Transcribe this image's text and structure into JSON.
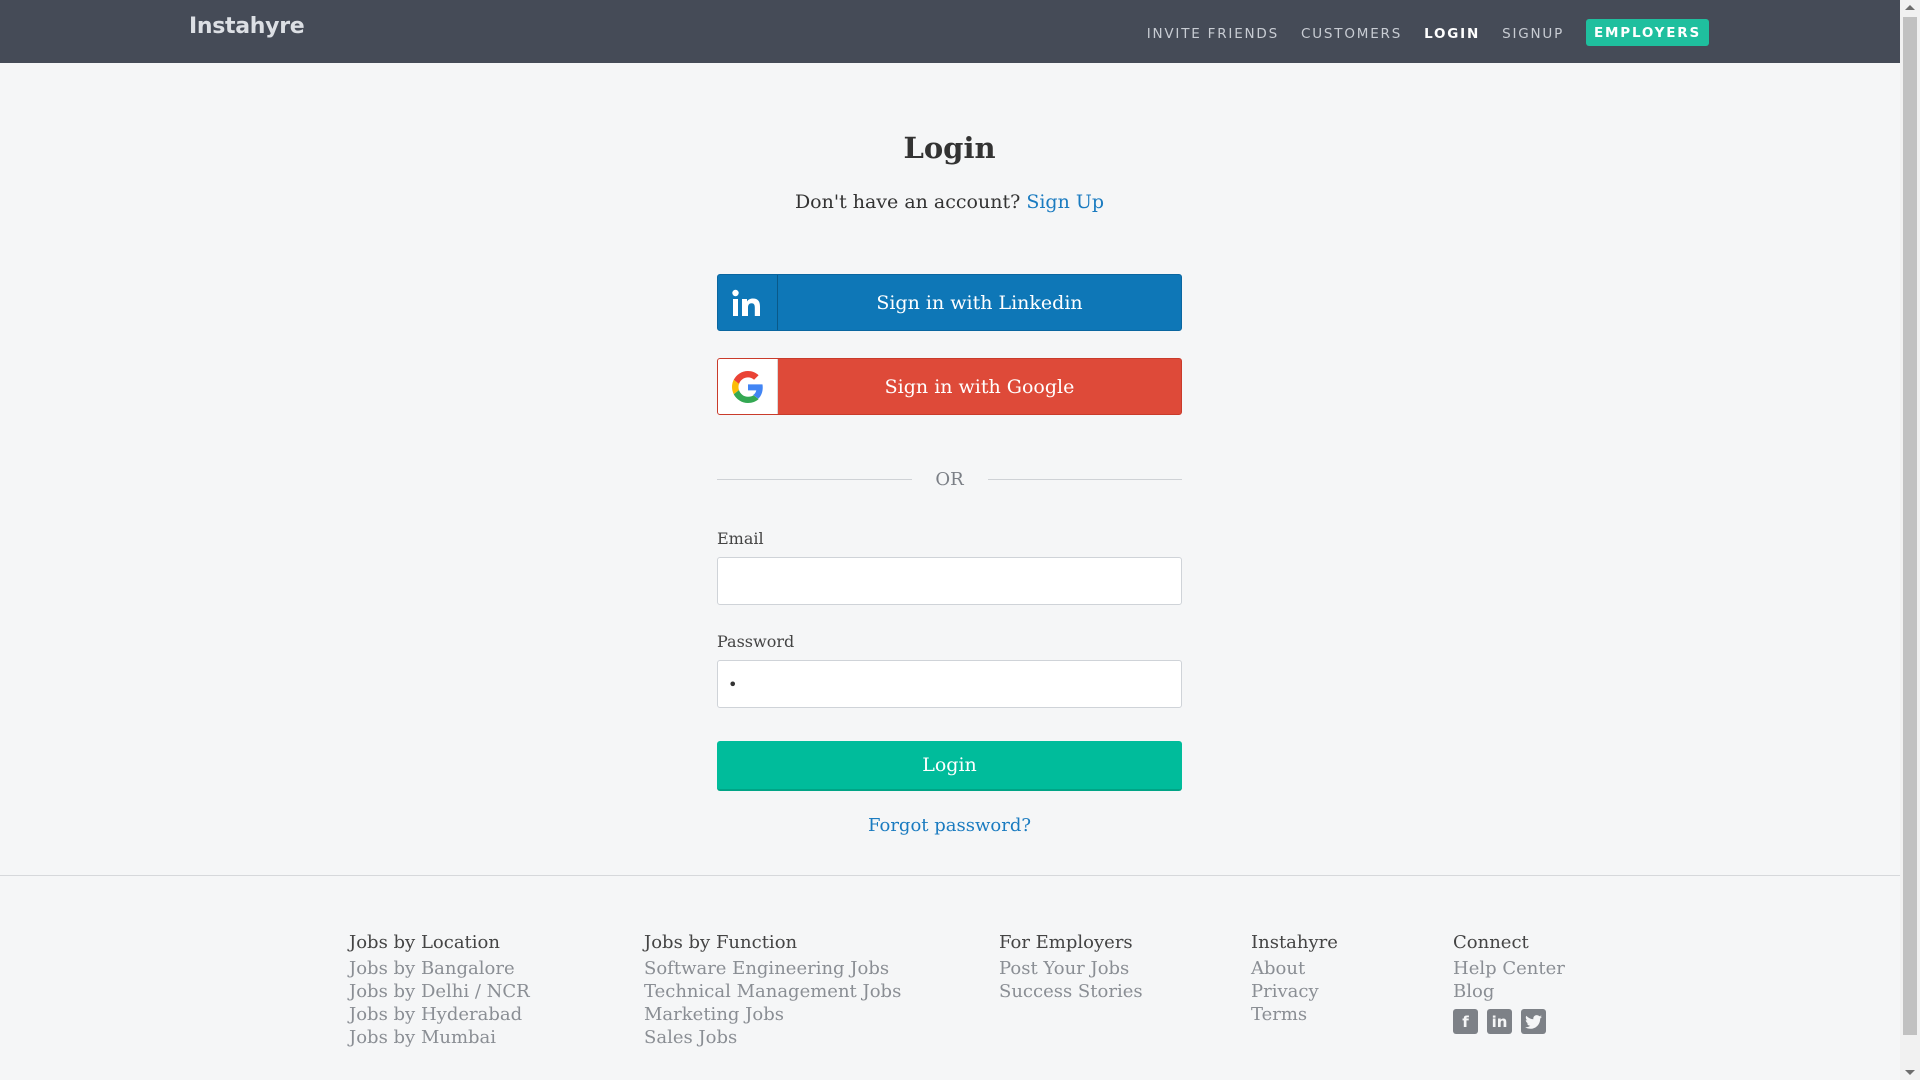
{
  "header": {
    "brand": "Instahyre",
    "nav": [
      {
        "label": "INVITE FRIENDS"
      },
      {
        "label": "CUSTOMERS"
      },
      {
        "label": "LOGIN"
      },
      {
        "label": "SIGNUP"
      }
    ],
    "employers_label": "EMPLOYERS"
  },
  "login": {
    "title": "Login",
    "no_account_text": "Don't have an account?",
    "signup_link": "Sign Up",
    "linkedin_label": "Sign in with Linkedin",
    "google_label": "Sign in with Google",
    "or_text": "OR",
    "email_label": "Email",
    "email_value": "",
    "password_label": "Password",
    "password_value": "•",
    "login_button": "Login",
    "forgot_password": "Forgot password?"
  },
  "footer": {
    "columns": [
      {
        "heading": "Jobs by Location",
        "links": [
          "Jobs by Bangalore",
          "Jobs by Delhi / NCR",
          "Jobs by Hyderabad",
          "Jobs by Mumbai"
        ]
      },
      {
        "heading": "Jobs by Function",
        "links": [
          "Software Engineering Jobs",
          "Technical Management Jobs",
          "Marketing Jobs",
          "Sales Jobs"
        ]
      },
      {
        "heading": "For Employers",
        "links": [
          "Post Your Jobs",
          "Success Stories"
        ]
      },
      {
        "heading": "Instahyre",
        "links": [
          "About",
          "Privacy",
          "Terms"
        ]
      },
      {
        "heading": "Connect",
        "links": [
          "Help Center",
          "Blog"
        ]
      }
    ],
    "social_icons": [
      "facebook-icon",
      "linkedin-icon",
      "twitter-icon"
    ]
  },
  "colors": {
    "header_bg": "#454b57",
    "accent": "#00bc9b",
    "linkedin": "#0e77b7",
    "google": "#de4a39",
    "link": "#1a7bc0"
  }
}
